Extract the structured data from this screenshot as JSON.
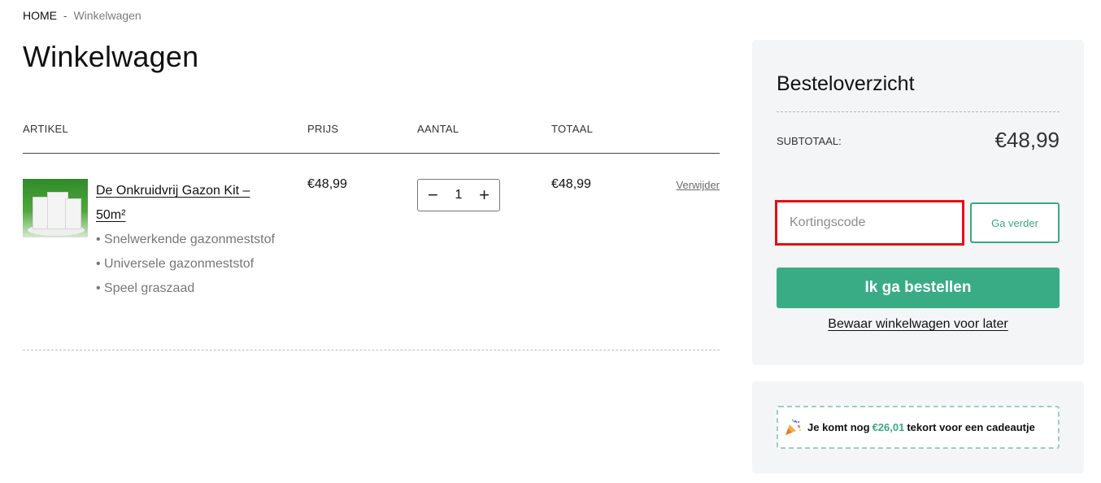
{
  "breadcrumb": {
    "home": "HOME",
    "separator": "-",
    "current": "Winkelwagen"
  },
  "page": {
    "title": "Winkelwagen"
  },
  "cart": {
    "columns": {
      "item": "ARTIKEL",
      "price": "PRIJS",
      "quantity": "AANTAL",
      "total": "TOTAAL"
    },
    "items": [
      {
        "name": "De Onkruidvrij Gazon Kit – 50m²",
        "features": [
          "• Snelwerkende gazonmeststof",
          "• Universele gazonmeststof",
          "• Speel graszaad"
        ],
        "price": "€48,99",
        "quantity": "1",
        "total": "€48,99",
        "remove_label": "Verwijder",
        "decrement_label": "−",
        "increment_label": "+"
      }
    ]
  },
  "summary": {
    "title": "Besteloverzicht",
    "subtotal_label": "SUBTOTAAL:",
    "subtotal_value": "€48,99",
    "coupon_placeholder": "Kortingscode",
    "coupon_button": "Ga verder",
    "checkout_button": "Ik ga bestellen",
    "save_cart_link": "Bewaar winkelwagen voor later"
  },
  "gift": {
    "text_before": "Je komt nog",
    "amount": "€26,01",
    "text_after": "tekort voor een cadeautje",
    "icon": "party-popper-icon"
  },
  "colors": {
    "accent": "#3aac85",
    "highlight_border": "#e10f17",
    "panel_bg": "#f4f5f6"
  }
}
